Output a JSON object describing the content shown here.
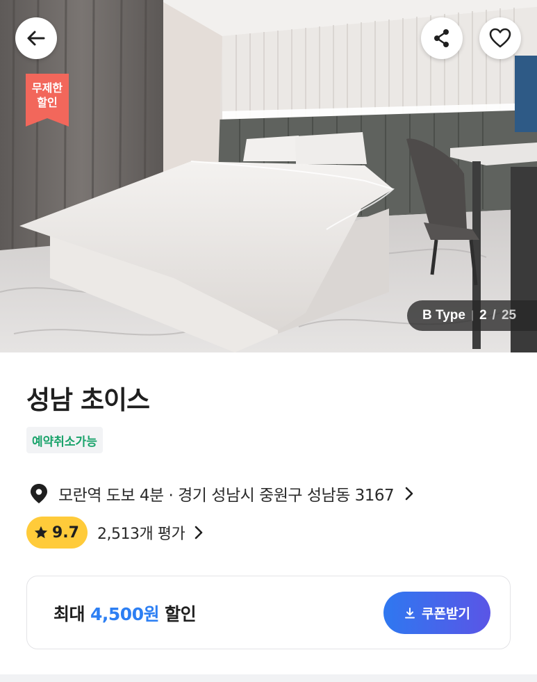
{
  "hero": {
    "promo_badge": "무제한\n할인",
    "room_type": "B Type",
    "photo_index": "2",
    "photo_total": "25",
    "colors": {
      "promo": "#f2675b",
      "counter_bg": "#282828"
    }
  },
  "header_actions": {
    "back": "back-arrow-icon",
    "share": "share-icon",
    "like": "heart-icon"
  },
  "property": {
    "name": "성남 초이스",
    "cancel_badge": "예약취소가능",
    "location": "모란역 도보 4분 · 경기 성남시 중원구 성남동 3167",
    "rating": "9.7",
    "review_count": "2,513개 평가"
  },
  "coupon": {
    "prefix": "최대",
    "amount": "4,500원",
    "suffix": "할인",
    "button_label": "쿠폰받기",
    "colors": {
      "amount": "#2d7ff3",
      "button_from": "#2f78f0",
      "button_to": "#5a55e6"
    }
  },
  "colors": {
    "rating_pill": "#ffcb3a",
    "cancel_text": "#1aa36b"
  }
}
